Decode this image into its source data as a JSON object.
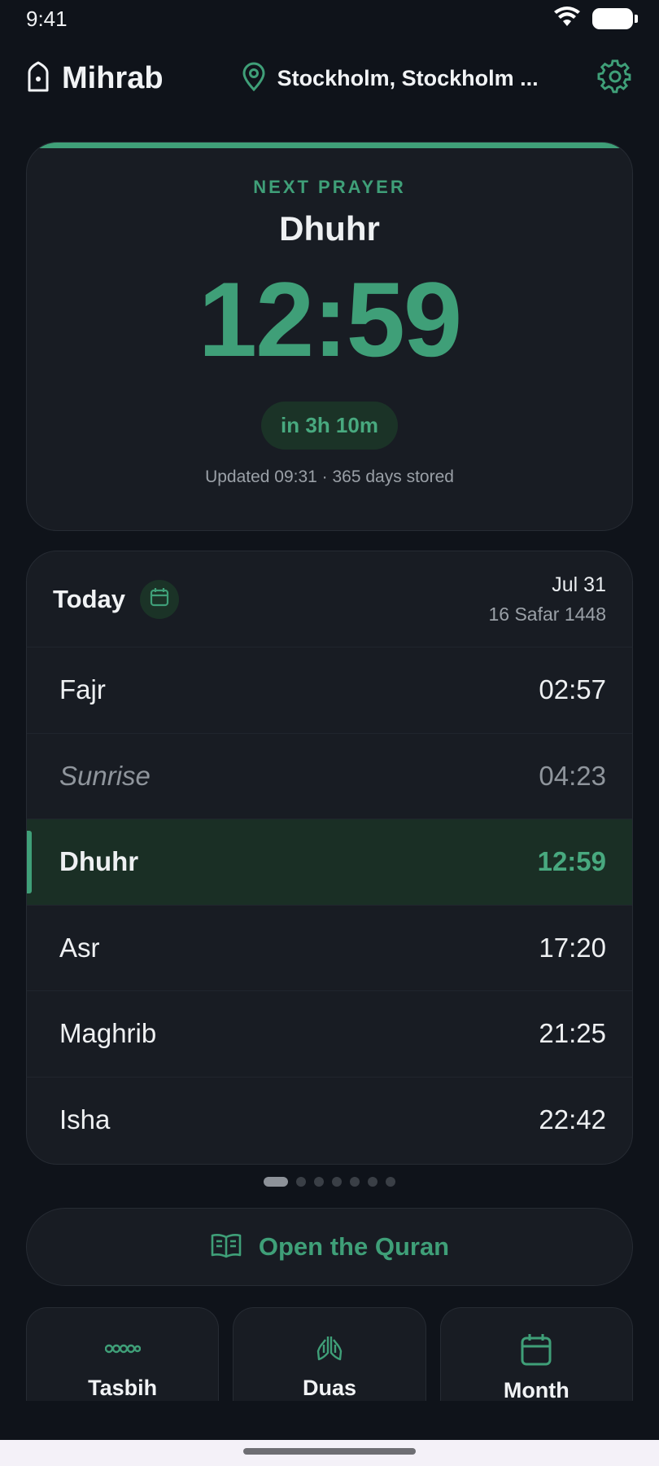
{
  "status_bar": {
    "time": "9:41"
  },
  "header": {
    "app_title": "Mihrab",
    "location": "Stockholm, Stockholm ...",
    "icons": {
      "logo": "mosque-icon",
      "location": "map-pin-icon",
      "settings": "gear-icon"
    }
  },
  "next_prayer": {
    "label": "NEXT PRAYER",
    "name": "Dhuhr",
    "time": "12:59",
    "countdown": "in 3h 10m",
    "updated": "Updated 09:31 · 365 days stored"
  },
  "today": {
    "label": "Today",
    "gregorian_date": "Jul 31",
    "hijri_date": "16 Safar 1448",
    "prayers": [
      {
        "name": "Fajr",
        "time": "02:57",
        "state": "normal"
      },
      {
        "name": "Sunrise",
        "time": "04:23",
        "state": "muted"
      },
      {
        "name": "Dhuhr",
        "time": "12:59",
        "state": "active"
      },
      {
        "name": "Asr",
        "time": "17:20",
        "state": "normal"
      },
      {
        "name": "Maghrib",
        "time": "21:25",
        "state": "normal"
      },
      {
        "name": "Isha",
        "time": "22:42",
        "state": "normal"
      }
    ]
  },
  "pager": {
    "pages": 7,
    "active_index": 0
  },
  "quran_button": {
    "label": "Open the Quran",
    "icon": "book-open-icon"
  },
  "tiles": [
    {
      "label": "Tasbih",
      "icon": "prayer-beads-icon"
    },
    {
      "label": "Duas",
      "icon": "praying-hands-icon"
    },
    {
      "label": "Month",
      "icon": "calendar-icon"
    }
  ],
  "colors": {
    "background": "#0f131a",
    "card": "#181c23",
    "accent": "#3f9f78",
    "active_row": "#1a2f25"
  }
}
